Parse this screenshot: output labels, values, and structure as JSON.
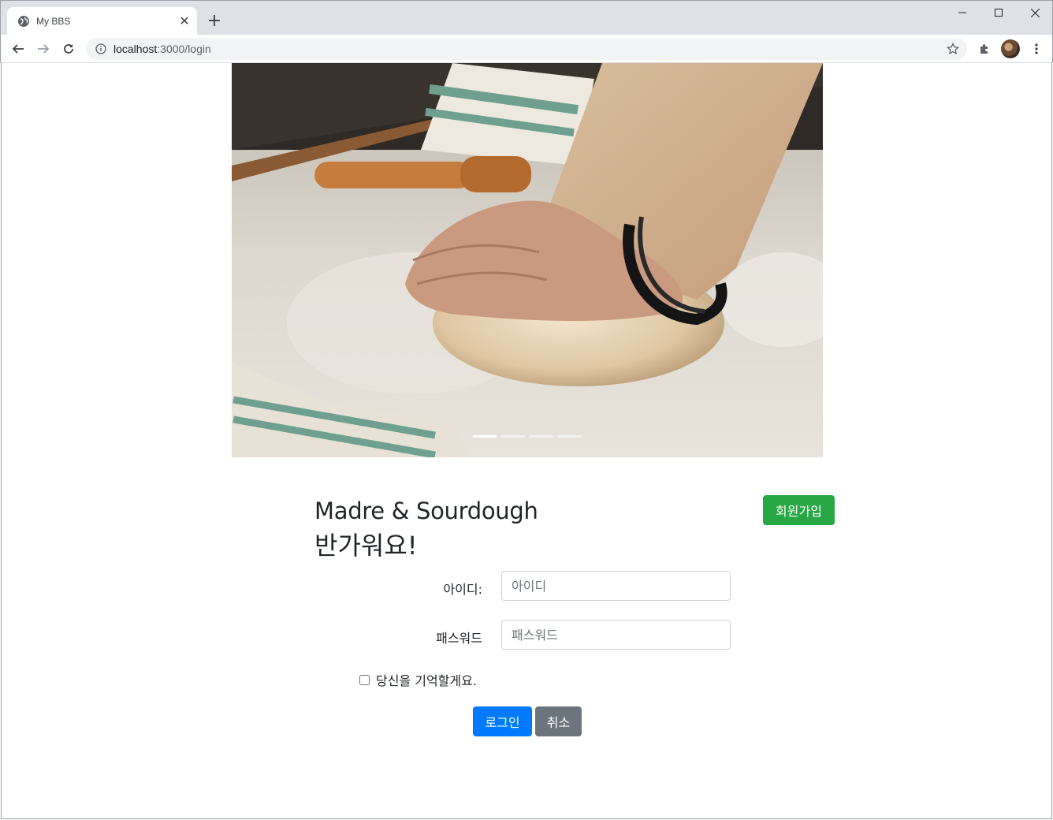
{
  "browser": {
    "tab_title": "My BBS",
    "url_host": "localhost",
    "url_rest": ":3000/login"
  },
  "carousel": {
    "image": "kneading-dough-photo",
    "indicators": [
      true,
      false,
      false,
      false
    ]
  },
  "header": {
    "title": "Madre & Sourdough",
    "subtitle": "반가워요!",
    "signup_label": "회원가입"
  },
  "form": {
    "id_label": "아이디:",
    "id_placeholder": "아이디",
    "id_value": "",
    "pw_label": "패스워드",
    "pw_placeholder": "패스워드",
    "pw_value": "",
    "remember_label": "당신을 기억할게요.",
    "remember_checked": false,
    "login_label": "로그인",
    "cancel_label": "취소"
  },
  "colors": {
    "success": "#28a745",
    "primary": "#007bff",
    "secondary": "#6c757d"
  }
}
